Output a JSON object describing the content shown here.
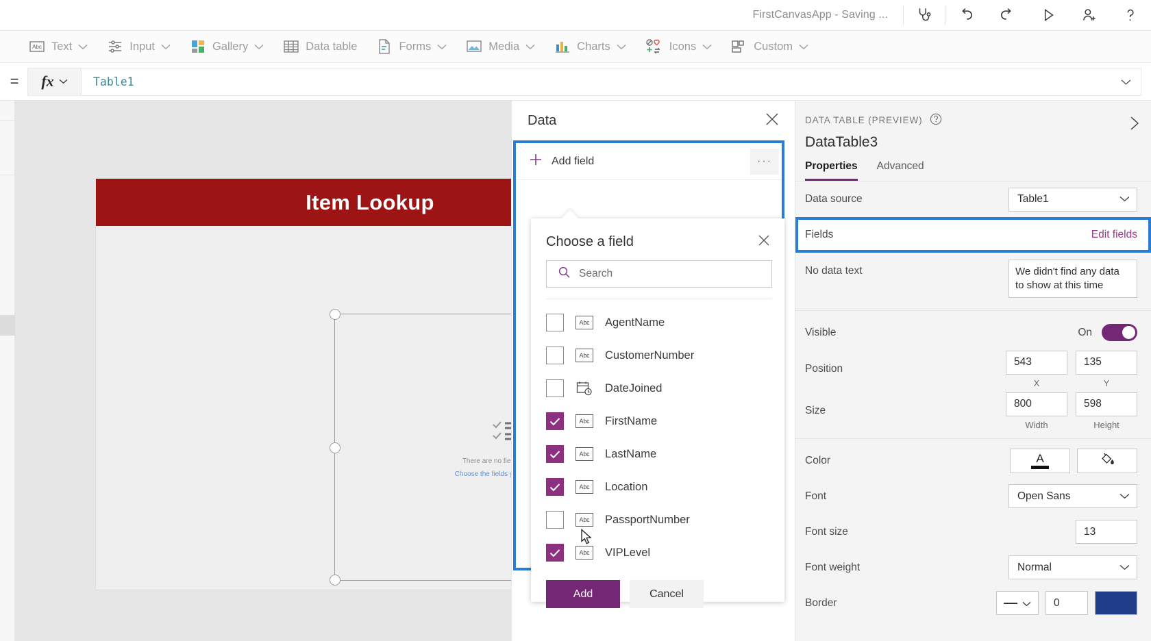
{
  "header": {
    "app_title": "FirstCanvasApp - Saving ...",
    "icons": [
      {
        "name": "app-checker-icon",
        "label": "App checker"
      },
      {
        "name": "undo-icon",
        "label": "Undo"
      },
      {
        "name": "redo-icon",
        "label": "Redo"
      },
      {
        "name": "play-preview-icon",
        "label": "Preview the app"
      },
      {
        "name": "share-user-icon",
        "label": "Share"
      },
      {
        "name": "help-icon",
        "label": "Help"
      }
    ]
  },
  "toolbar": {
    "items": [
      {
        "label": "Text",
        "icon": "text-abc-icon",
        "caret": true
      },
      {
        "label": "Input",
        "icon": "input-sliders-icon",
        "caret": true
      },
      {
        "label": "Gallery",
        "icon": "gallery-squares-icon",
        "caret": true
      },
      {
        "label": "Data table",
        "icon": "data-table-grid-icon",
        "caret": false
      },
      {
        "label": "Forms",
        "icon": "forms-page-icon",
        "caret": true
      },
      {
        "label": "Media",
        "icon": "media-image-icon",
        "caret": true
      },
      {
        "label": "Charts",
        "icon": "charts-bar-icon",
        "caret": true
      },
      {
        "label": "Icons",
        "icon": "icons-shapes-icon",
        "caret": true
      },
      {
        "label": "Custom",
        "icon": "custom-blocks-icon",
        "caret": true
      }
    ]
  },
  "formula_bar": {
    "equals": "=",
    "fx_label": "fx",
    "value": "Table1"
  },
  "canvas": {
    "screen_header_title": "Item Lookup",
    "datatable_empty_line1": "There are no fields to display",
    "datatable_empty_line2": "Choose the fields you want to add"
  },
  "data_panel": {
    "title": "Data",
    "add_field_label": "Add field",
    "overflow_label": "···",
    "flyout": {
      "title": "Choose a field",
      "search_placeholder": "Search",
      "fields": [
        {
          "label": "AgentName",
          "type": "Abc",
          "checked": false
        },
        {
          "label": "CustomerNumber",
          "type": "Abc",
          "checked": false
        },
        {
          "label": "DateJoined",
          "type": "date",
          "checked": false
        },
        {
          "label": "FirstName",
          "type": "Abc",
          "checked": true
        },
        {
          "label": "LastName",
          "type": "Abc",
          "checked": true
        },
        {
          "label": "Location",
          "type": "Abc",
          "checked": true
        },
        {
          "label": "PassportNumber",
          "type": "Abc",
          "checked": false
        },
        {
          "label": "VIPLevel",
          "type": "Abc",
          "checked": true
        }
      ],
      "add_button": "Add",
      "cancel_button": "Cancel"
    }
  },
  "properties": {
    "kicker": "DATA TABLE (PREVIEW)",
    "control_name": "DataTable3",
    "tabs": [
      {
        "label": "Properties",
        "active": true
      },
      {
        "label": "Advanced",
        "active": false
      }
    ],
    "data_source": {
      "label": "Data source",
      "value": "Table1"
    },
    "fields": {
      "label": "Fields",
      "action": "Edit fields"
    },
    "no_data_text": {
      "label": "No data text",
      "value": "We didn't find any data to show at this time"
    },
    "visible": {
      "label": "Visible",
      "state": "On"
    },
    "position": {
      "label": "Position",
      "x": "543",
      "y": "135",
      "x_caption": "X",
      "y_caption": "Y"
    },
    "size": {
      "label": "Size",
      "width": "800",
      "height": "598",
      "width_caption": "Width",
      "height_caption": "Height"
    },
    "color": {
      "label": "Color"
    },
    "font": {
      "label": "Font",
      "value": "Open Sans"
    },
    "font_size": {
      "label": "Font size",
      "value": "13"
    },
    "font_weight": {
      "label": "Font weight",
      "value": "Normal"
    },
    "border": {
      "label": "Border",
      "style": "—",
      "width": "0",
      "color_hex": "#1f3c88"
    }
  },
  "colors": {
    "accent_purple": "#742774",
    "checkbox_purple": "#8d3080",
    "highlight_blue": "#2b7cd3",
    "screen_header_red": "#9c1414",
    "formula_teal": "#3b8a94"
  }
}
